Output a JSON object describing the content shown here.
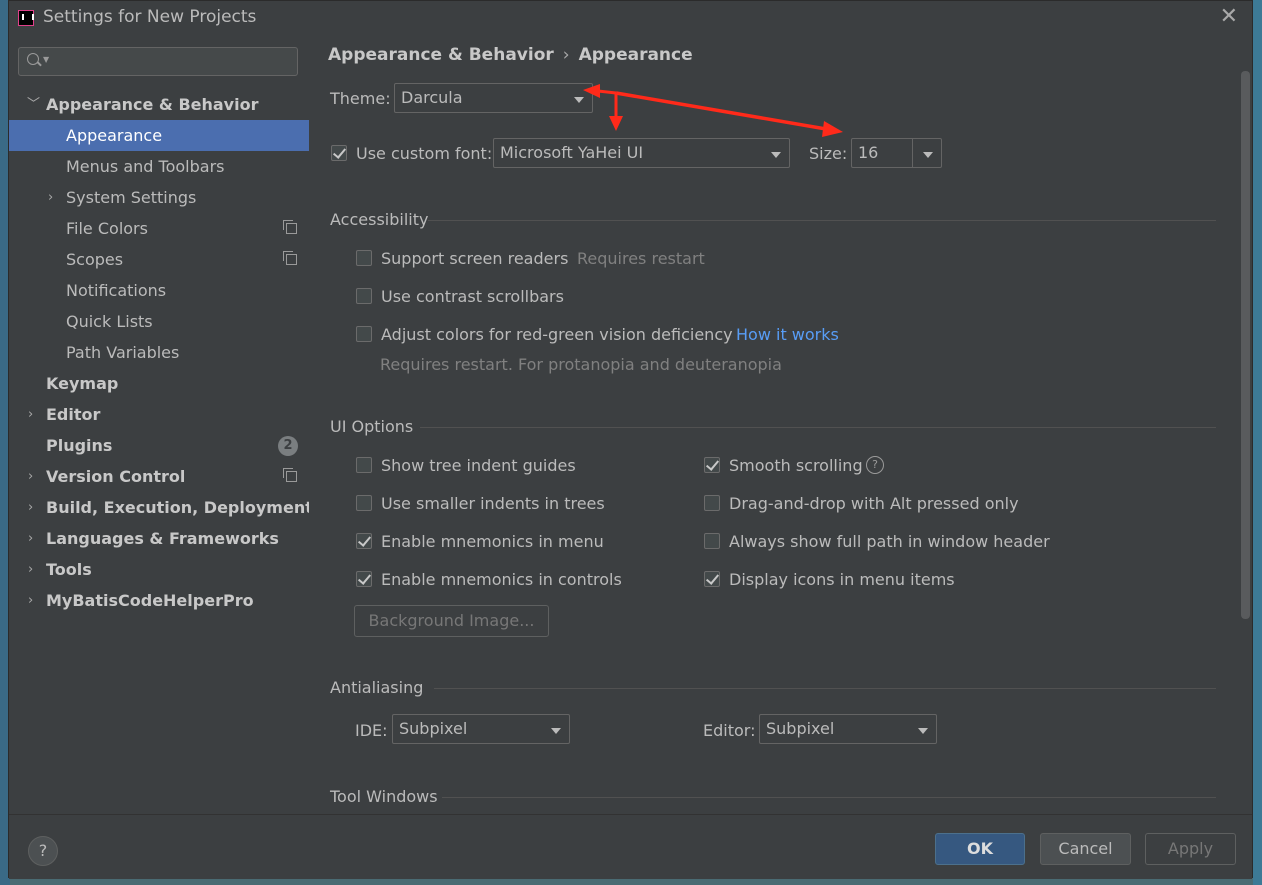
{
  "window": {
    "title": "Settings for New Projects"
  },
  "search": {
    "placeholder": ""
  },
  "sidebar": {
    "items": [
      {
        "label": "Appearance & Behavior"
      },
      {
        "label": "Appearance"
      },
      {
        "label": "Menus and Toolbars"
      },
      {
        "label": "System Settings"
      },
      {
        "label": "File Colors"
      },
      {
        "label": "Scopes"
      },
      {
        "label": "Notifications"
      },
      {
        "label": "Quick Lists"
      },
      {
        "label": "Path Variables"
      },
      {
        "label": "Keymap"
      },
      {
        "label": "Editor"
      },
      {
        "label": "Plugins",
        "badge": "2"
      },
      {
        "label": "Version Control"
      },
      {
        "label": "Build, Execution, Deployment"
      },
      {
        "label": "Languages & Frameworks"
      },
      {
        "label": "Tools"
      },
      {
        "label": "MyBatisCodeHelperPro"
      }
    ]
  },
  "breadcrumb": {
    "parent": "Appearance & Behavior",
    "current": "Appearance",
    "separator": "›"
  },
  "theme": {
    "label": "Theme:",
    "value": "Darcula"
  },
  "font": {
    "checkbox_label": "Use custom font:",
    "checked": true,
    "value": "Microsoft YaHei UI",
    "size_label": "Size:",
    "size_value": "16"
  },
  "accessibility": {
    "title": "Accessibility",
    "screen_readers": {
      "label": "Support screen readers",
      "note": "Requires restart",
      "checked": false
    },
    "contrast_scrollbars": {
      "label": "Use contrast scrollbars",
      "checked": false
    },
    "color_deficiency": {
      "label": "Adjust colors for red-green vision deficiency",
      "link": "How it works",
      "note": "Requires restart. For protanopia and deuteranopia",
      "checked": false
    }
  },
  "ui_options": {
    "title": "UI Options",
    "left": [
      {
        "label": "Show tree indent guides",
        "checked": false
      },
      {
        "label": "Use smaller indents in trees",
        "checked": false
      },
      {
        "label": "Enable mnemonics in menu",
        "checked": true
      },
      {
        "label": "Enable mnemonics in controls",
        "checked": true
      }
    ],
    "right": [
      {
        "label": "Smooth scrolling",
        "checked": true
      },
      {
        "label": "Drag-and-drop with Alt pressed only",
        "checked": false
      },
      {
        "label": "Always show full path in window header",
        "checked": false
      },
      {
        "label": "Display icons in menu items",
        "checked": true
      }
    ],
    "background_button": "Background Image..."
  },
  "antialiasing": {
    "title": "Antialiasing",
    "ide_label": "IDE:",
    "ide_value": "Subpixel",
    "editor_label": "Editor:",
    "editor_value": "Subpixel"
  },
  "tool_windows": {
    "title": "Tool Windows"
  },
  "footer": {
    "help": "?",
    "ok": "OK",
    "cancel": "Cancel",
    "apply": "Apply"
  },
  "colors": {
    "accent": "#4b6eaf",
    "link": "#589df6",
    "annotation_arrow": "#ff2a1a"
  }
}
